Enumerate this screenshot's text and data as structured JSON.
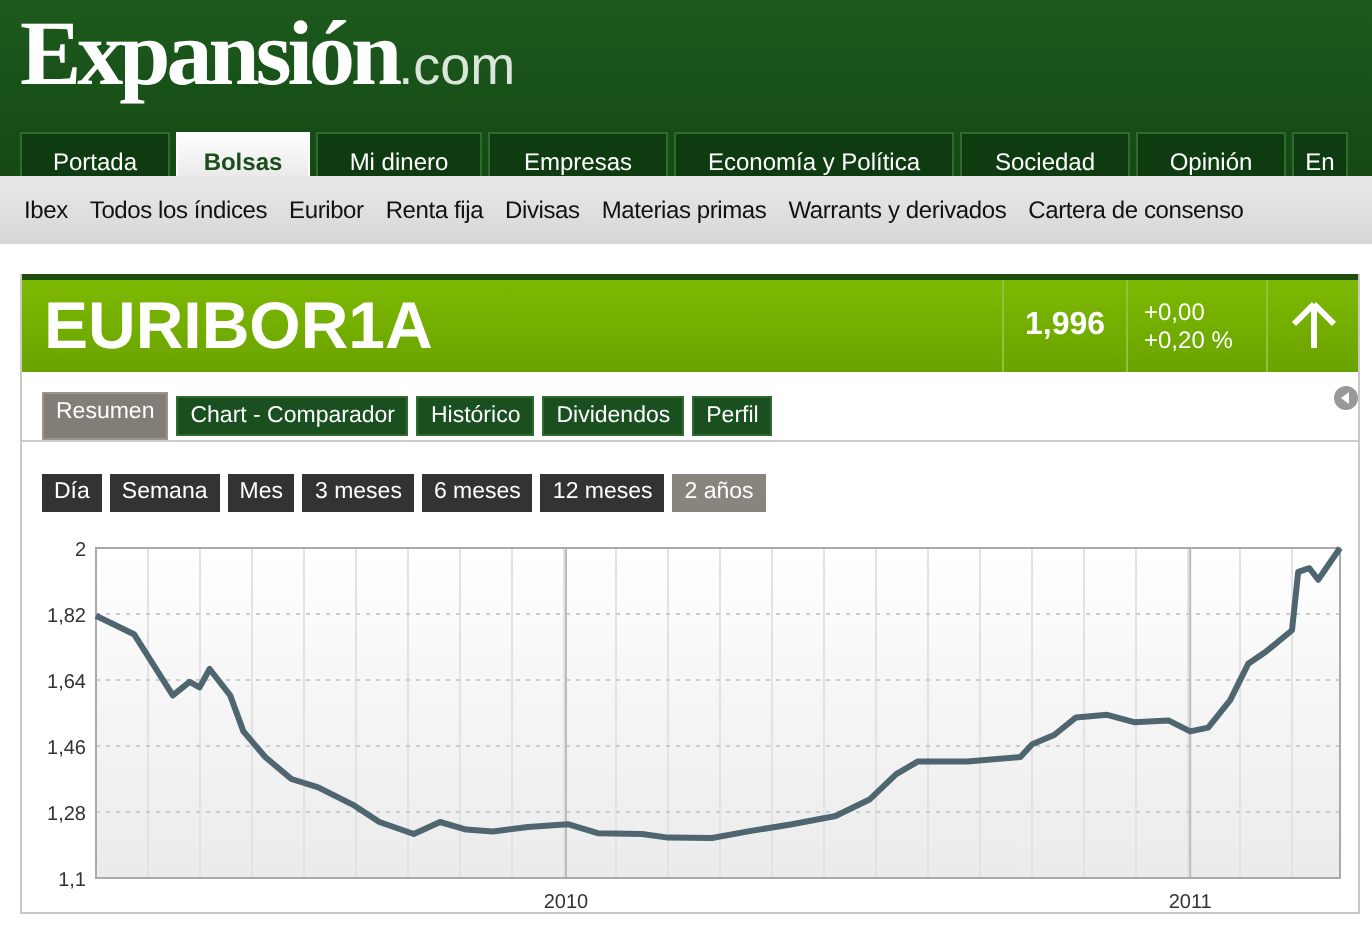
{
  "logo": {
    "name": "Expansión",
    "suffix": ".com"
  },
  "nav_tabs": [
    {
      "label": "Portada",
      "selected": false
    },
    {
      "label": "Bolsas",
      "selected": true
    },
    {
      "label": "Mi dinero",
      "selected": false
    },
    {
      "label": "Empresas",
      "selected": false
    },
    {
      "label": "Economía y Política",
      "selected": false
    },
    {
      "label": "Sociedad",
      "selected": false
    },
    {
      "label": "Opinión",
      "selected": false
    },
    {
      "label": "En",
      "selected": false
    }
  ],
  "sub_nav": [
    "Ibex",
    "Todos los índices",
    "Euribor",
    "Renta fija",
    "Divisas",
    "Materias primas",
    "Warrants y derivados",
    "Cartera de consenso"
  ],
  "quote": {
    "symbol": "EURIBOR1A",
    "price": "1,996",
    "change": "+0,00",
    "change_pct": "+0,20 %"
  },
  "section_tabs": [
    {
      "label": "Resumen",
      "selected": true
    },
    {
      "label": "Chart - Comparador",
      "selected": false
    },
    {
      "label": "Histórico",
      "selected": false
    },
    {
      "label": "Dividendos",
      "selected": false
    },
    {
      "label": "Perfil",
      "selected": false
    }
  ],
  "periods": [
    {
      "label": "Día",
      "selected": false
    },
    {
      "label": "Semana",
      "selected": false
    },
    {
      "label": "Mes",
      "selected": false
    },
    {
      "label": "3 meses",
      "selected": false
    },
    {
      "label": "6 meses",
      "selected": false
    },
    {
      "label": "12 meses",
      "selected": false
    },
    {
      "label": "2 años",
      "selected": true
    }
  ],
  "chart": {
    "chart_data": {
      "type": "line",
      "x": [
        2009.247,
        2009.308,
        2009.37,
        2009.397,
        2009.413,
        2009.429,
        2009.462,
        2009.483,
        2009.518,
        2009.56,
        2009.603,
        2009.658,
        2009.701,
        2009.756,
        2009.798,
        2009.84,
        2009.883,
        2009.939,
        2010.003,
        2010.051,
        2010.122,
        2010.163,
        2010.234,
        2010.292,
        2010.362,
        2010.432,
        2010.487,
        2010.529,
        2010.564,
        2010.643,
        2010.728,
        2010.747,
        2010.782,
        2010.817,
        2010.867,
        2010.91,
        2010.965,
        2011.0,
        2011.029,
        2011.064,
        2011.093,
        2011.121,
        2011.163,
        2011.173,
        2011.191,
        2011.205,
        2011.24
      ],
      "grid": true,
      "series": [
        {
          "color": "#4f6670",
          "values": [
            1.815,
            1.765,
            1.598,
            1.635,
            1.62,
            1.67,
            1.598,
            1.5,
            1.43,
            1.37,
            1.347,
            1.3,
            1.253,
            1.22,
            1.253,
            1.232,
            1.227,
            1.239,
            1.247,
            1.222,
            1.22,
            1.21,
            1.209,
            1.227,
            1.247,
            1.269,
            1.315,
            1.383,
            1.418,
            1.418,
            1.43,
            1.465,
            1.49,
            1.538,
            1.545,
            1.525,
            1.53,
            1.5,
            1.51,
            1.585,
            1.684,
            1.717,
            1.776,
            1.935,
            1.945,
            1.913,
            2.0
          ]
        }
      ],
      "xlim": [
        2009.247,
        2011.24
      ],
      "ylim": [
        1.1,
        2
      ],
      "xticks": [
        {
          "value": 2010,
          "label": "2010"
        },
        {
          "value": 2011,
          "label": "2011"
        }
      ],
      "yticks": [
        {
          "value": 1.1,
          "label": "1,1"
        },
        {
          "value": 1.28,
          "label": "1,28"
        },
        {
          "value": 1.46,
          "label": "1,46"
        },
        {
          "value": 1.64,
          "label": "1,64"
        },
        {
          "value": 1.82,
          "label": "1,82"
        },
        {
          "value": 2,
          "label": "2"
        }
      ]
    }
  }
}
